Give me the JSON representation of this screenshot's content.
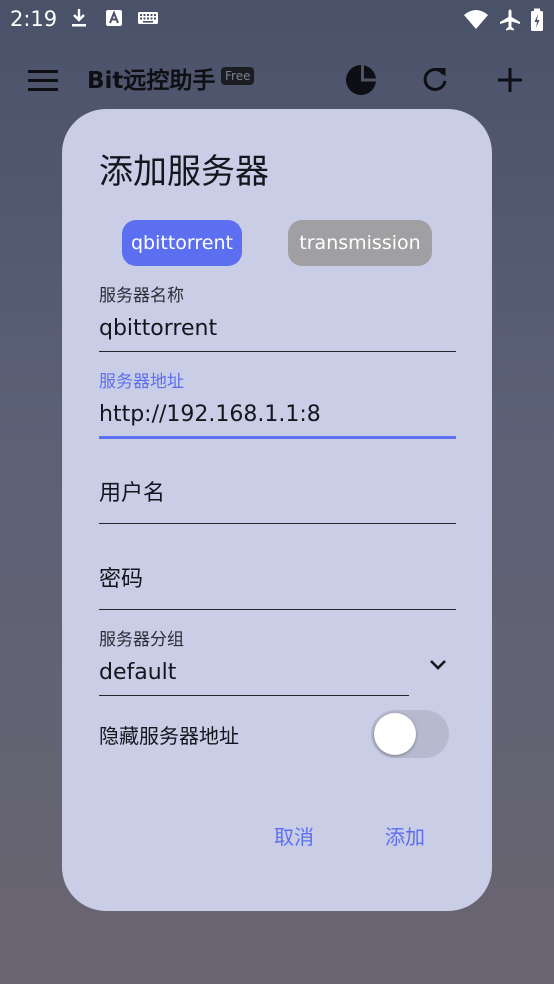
{
  "status_bar": {
    "time": "2:19",
    "left_icons": [
      "download-icon",
      "text-a-icon",
      "keyboard-icon"
    ],
    "right_icons": [
      "wifi-icon",
      "airplane-icon",
      "battery-icon"
    ]
  },
  "app_bar": {
    "title": "Bit远控助手",
    "badge": "Free",
    "icons": [
      "menu-icon",
      "pie-chart-icon",
      "refresh-icon",
      "add-icon"
    ]
  },
  "dialog": {
    "title": "添加服务器",
    "client_types": [
      {
        "label": "qbittorrent",
        "selected": true
      },
      {
        "label": "transmission",
        "selected": false
      }
    ],
    "fields": {
      "server_name": {
        "label": "服务器名称",
        "value": "qbittorrent"
      },
      "server_address": {
        "label": "服务器地址",
        "value": "http://192.168.1.1:8",
        "focused": true
      },
      "username": {
        "placeholder": "用户名",
        "value": ""
      },
      "password": {
        "placeholder": "密码",
        "value": ""
      },
      "server_group": {
        "label": "服务器分组",
        "value": "default"
      }
    },
    "hide_address": {
      "label": "隐藏服务器地址",
      "on": false
    },
    "buttons": {
      "cancel": "取消",
      "add": "添加"
    }
  },
  "colors": {
    "accent": "#5b6ff0",
    "dialog_bg": "#c9cde6",
    "chip_unselected": "#a09fa2"
  }
}
